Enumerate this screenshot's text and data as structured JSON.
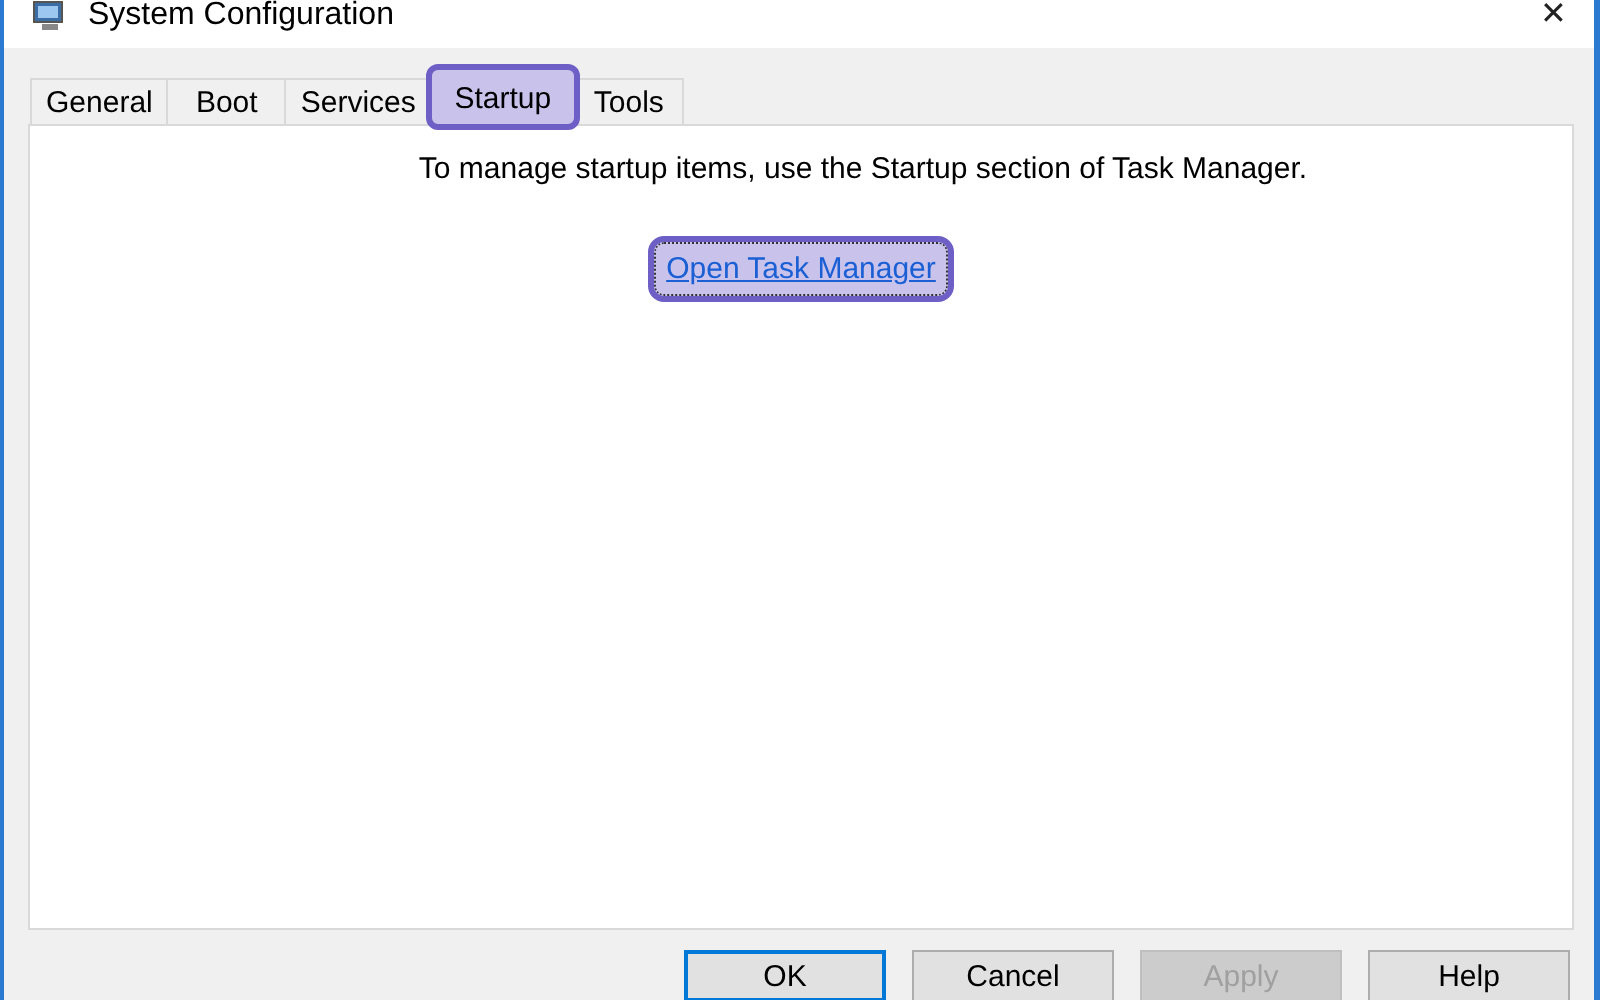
{
  "window": {
    "title": "System Configuration",
    "close": "✕"
  },
  "tabs": [
    {
      "label": "General",
      "selected": false,
      "highlighted": false
    },
    {
      "label": "Boot",
      "selected": false,
      "highlighted": false
    },
    {
      "label": "Services",
      "selected": false,
      "highlighted": false
    },
    {
      "label": "Startup",
      "selected": true,
      "highlighted": true
    },
    {
      "label": "Tools",
      "selected": false,
      "highlighted": false
    }
  ],
  "startup": {
    "message": "To manage startup items, use the Startup section of Task Manager.",
    "link": {
      "label": "Open Task Manager",
      "highlighted": true
    }
  },
  "buttons": [
    {
      "label": "OK",
      "default": true,
      "disabled": false
    },
    {
      "label": "Cancel",
      "default": false,
      "disabled": false
    },
    {
      "label": "Apply",
      "default": false,
      "disabled": true
    },
    {
      "label": "Help",
      "default": false,
      "disabled": false
    }
  ]
}
